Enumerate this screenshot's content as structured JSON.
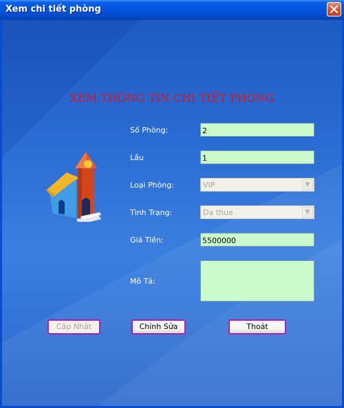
{
  "window": {
    "title": "Xem chi tiết phòng"
  },
  "form": {
    "heading": "XEM THÔNG TIN CHI TIẾT PHÒNG",
    "fields": {
      "room_number": {
        "label": "Số Phòng:",
        "value": "2"
      },
      "floor": {
        "label": "Lầu",
        "value": "1"
      },
      "room_type": {
        "label": "Loại Phòng:",
        "value": "VIP"
      },
      "status": {
        "label": "Tình Trạng:",
        "value": "Da thue"
      },
      "price": {
        "label": "Giá Tiền:",
        "value": "5500000"
      },
      "description": {
        "label": "Mô Tả:",
        "value": ""
      }
    }
  },
  "buttons": {
    "update": "Cập Nhật",
    "edit": "Chỉnh Sửa",
    "exit": "Thoát"
  },
  "icons": {
    "close": "close-icon",
    "house": "house-icon",
    "dropdown": "chevron-down-icon"
  },
  "colors": {
    "heading": "#e0141c",
    "input_bg": "#ccfccc",
    "button_border": "#b21bb0",
    "title_bar": "#0553dc"
  }
}
